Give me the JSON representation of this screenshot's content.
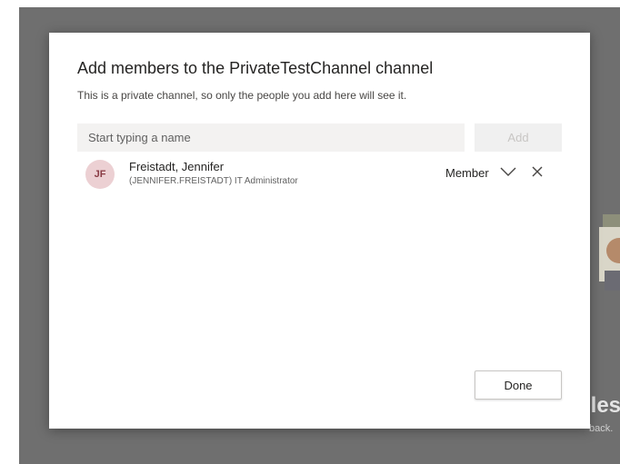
{
  "background": {
    "partial_heading": "iles",
    "partial_caption": "back."
  },
  "dialog": {
    "title": "Add members to the PrivateTestChannel channel",
    "subtitle": "This is a private channel, so only the people you add here will see it.",
    "search": {
      "placeholder": "Start typing a name",
      "value": ""
    },
    "add_label": "Add",
    "members": [
      {
        "initials": "JF",
        "name": "Freistadt, Jennifer",
        "detail": "(JENNIFER.FREISTADT) IT Administrator",
        "role": "Member",
        "icons": [
          "chevron-down-icon",
          "close-icon"
        ]
      }
    ],
    "done_label": "Done"
  },
  "colors": {
    "backdrop": "#6f6f6f",
    "avatar_bg": "#ecd0d3",
    "avatar_text": "#8a3c45",
    "input_bg": "#f3f2f1"
  }
}
